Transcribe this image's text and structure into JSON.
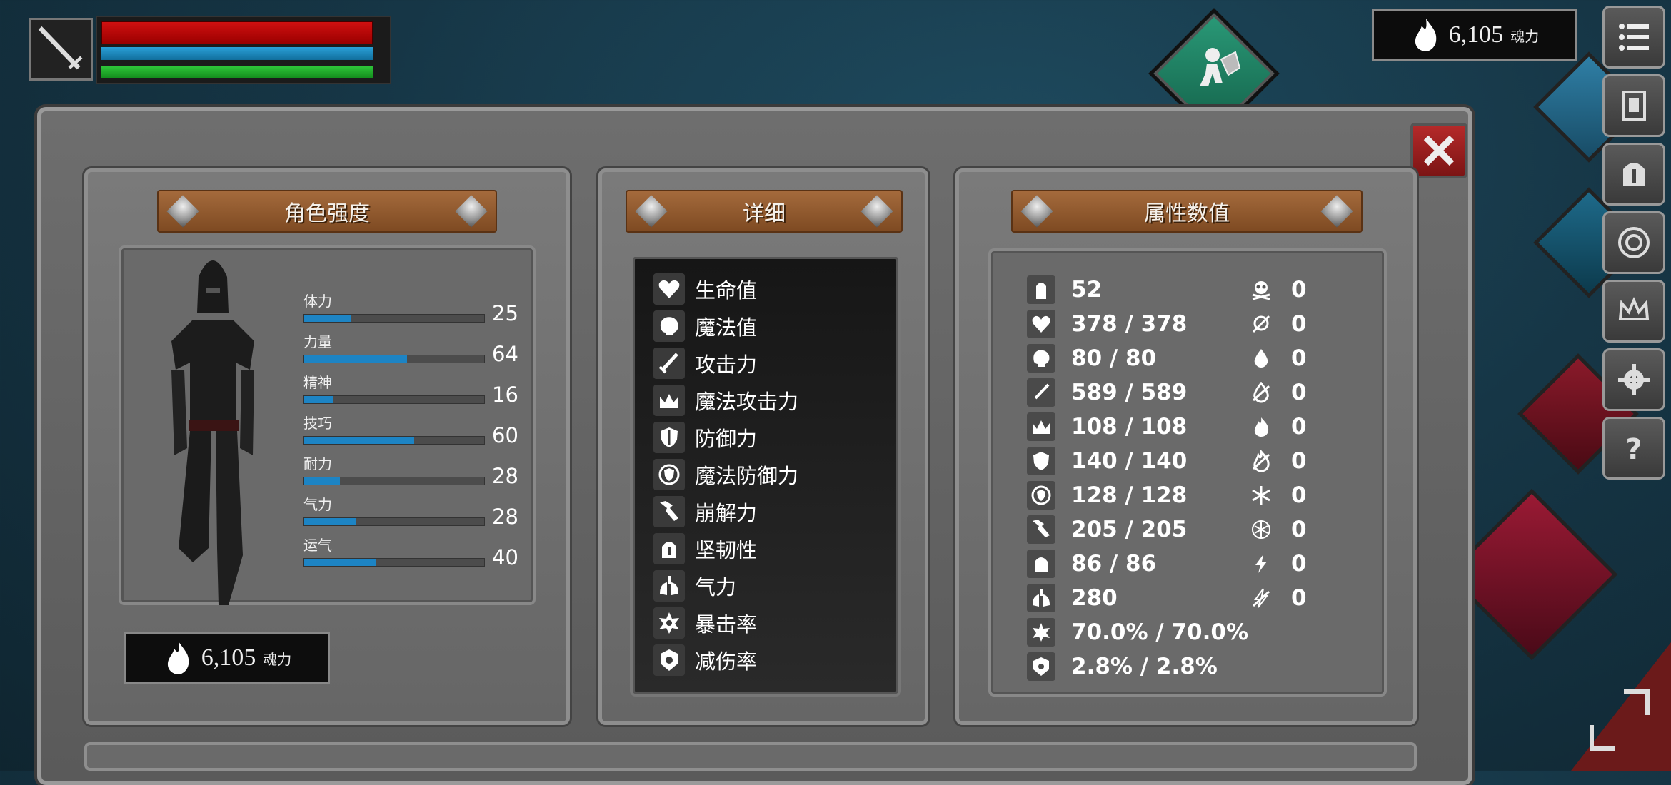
{
  "hud": {
    "weapon_icon": "sword-icon",
    "hp_fraction": 0.97,
    "mp_fraction": 0.97,
    "stamina_fraction": 0.97,
    "soul_amount": "6,105",
    "soul_unit": "魂力"
  },
  "right_menu": [
    "list-menu-icon",
    "character-sheet-icon",
    "helmet-icon",
    "rune-icon",
    "crown-icon",
    "gear-icon",
    "help-icon"
  ],
  "panels": {
    "strength": {
      "title": "角色强度",
      "stats": [
        {
          "label": "体力",
          "value": "25",
          "fraction": 0.26
        },
        {
          "label": "力量",
          "value": "64",
          "fraction": 0.57
        },
        {
          "label": "精神",
          "value": "16",
          "fraction": 0.16
        },
        {
          "label": "技巧",
          "value": "60",
          "fraction": 0.61
        },
        {
          "label": "耐力",
          "value": "28",
          "fraction": 0.2
        },
        {
          "label": "气力",
          "value": "28",
          "fraction": 0.29
        },
        {
          "label": "运气",
          "value": "40",
          "fraction": 0.4
        }
      ],
      "soul_amount": "6,105",
      "soul_unit": "魂力"
    },
    "detail": {
      "title": "详细",
      "items": [
        {
          "icon": "heart-icon",
          "label": "生命值"
        },
        {
          "icon": "brain-icon",
          "label": "魔法值"
        },
        {
          "icon": "sword-icon",
          "label": "攻击力"
        },
        {
          "icon": "crown-magic-icon",
          "label": "魔法攻击力"
        },
        {
          "icon": "shield-icon",
          "label": "防御力"
        },
        {
          "icon": "magic-shield-icon",
          "label": "魔法防御力"
        },
        {
          "icon": "shatter-icon",
          "label": "崩解力"
        },
        {
          "icon": "helmet-icon",
          "label": "坚韧性"
        },
        {
          "icon": "lungs-icon",
          "label": "气力"
        },
        {
          "icon": "critical-star-icon",
          "label": "暴击率"
        },
        {
          "icon": "damage-reduction-icon",
          "label": "减伤率"
        }
      ]
    },
    "attributes": {
      "title": "属性数值",
      "left": [
        {
          "icon": "level-icon",
          "value": "52"
        },
        {
          "icon": "heart-icon",
          "value": "378 / 378"
        },
        {
          "icon": "brain-icon",
          "value": "80 / 80"
        },
        {
          "icon": "sword-icon",
          "value": "589 / 589"
        },
        {
          "icon": "crown-magic-icon",
          "value": "108 / 108"
        },
        {
          "icon": "shield-icon",
          "value": "140 / 140"
        },
        {
          "icon": "magic-shield-icon",
          "value": "128 / 128"
        },
        {
          "icon": "shatter-icon",
          "value": "205 / 205"
        },
        {
          "icon": "helmet-icon",
          "value": "86 / 86"
        },
        {
          "icon": "lungs-icon",
          "value": "280"
        },
        {
          "icon": "critical-star-icon",
          "value": "70.0% / 70.0%"
        },
        {
          "icon": "damage-reduction-icon",
          "value": "2.8% / 2.8%"
        }
      ],
      "right": [
        {
          "icon": "poison-skull-icon",
          "value": "0"
        },
        {
          "icon": "poison-resist-icon",
          "value": "0"
        },
        {
          "icon": "bleed-icon",
          "value": "0"
        },
        {
          "icon": "bleed-resist-icon",
          "value": "0"
        },
        {
          "icon": "fire-icon",
          "value": "0"
        },
        {
          "icon": "fire-resist-icon",
          "value": "0"
        },
        {
          "icon": "frost-icon",
          "value": "0"
        },
        {
          "icon": "frost-resist-icon",
          "value": "0"
        },
        {
          "icon": "lightning-icon",
          "value": "0"
        },
        {
          "icon": "lightning-resist-icon",
          "value": "0"
        }
      ]
    }
  },
  "colors": {
    "hp": "#c80a0a",
    "mp": "#1f8ac4",
    "stamina": "#22b02c",
    "accent_wood": "#96602f",
    "close": "#9c1f1f"
  }
}
